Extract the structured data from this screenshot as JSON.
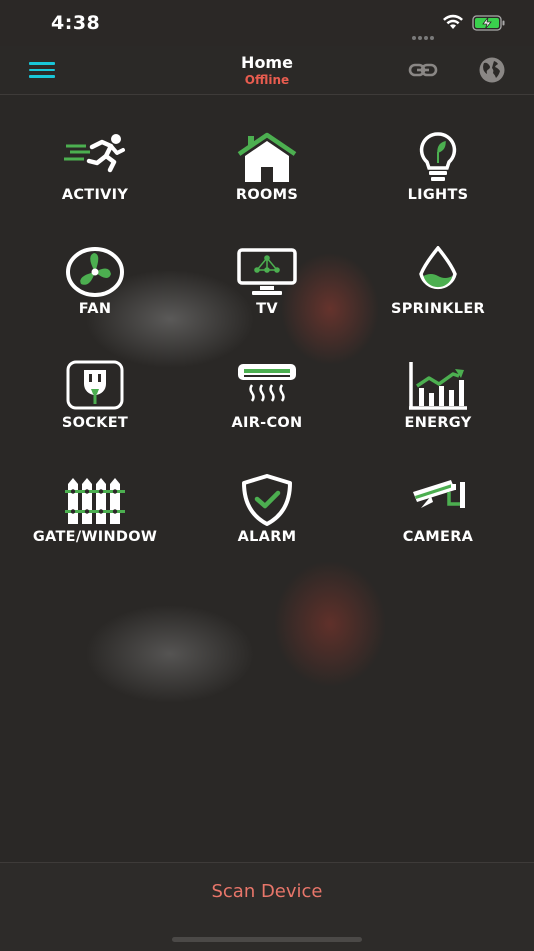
{
  "status_bar": {
    "time": "4:38"
  },
  "header": {
    "title": "Home",
    "status": "Offline"
  },
  "colors": {
    "accent_cyan": "#19c6d8",
    "icon_green": "#4caf50",
    "offline_red": "#e85c4f",
    "scan_text": "#e8766a"
  },
  "devices": [
    {
      "label": "ACTIVIY",
      "icon": "running-person-icon"
    },
    {
      "label": "ROOMS",
      "icon": "house-icon"
    },
    {
      "label": "LIGHTS",
      "icon": "lightbulb-icon"
    },
    {
      "label": "FAN",
      "icon": "fan-icon"
    },
    {
      "label": "TV",
      "icon": "tv-icon"
    },
    {
      "label": "SPRINKLER",
      "icon": "water-drop-icon"
    },
    {
      "label": "SOCKET",
      "icon": "socket-icon"
    },
    {
      "label": "AIR-CON",
      "icon": "air-conditioner-icon"
    },
    {
      "label": "ENERGY",
      "icon": "energy-chart-icon"
    },
    {
      "label": "GATE/WINDOW",
      "icon": "fence-icon"
    },
    {
      "label": "ALARM",
      "icon": "shield-check-icon"
    },
    {
      "label": "CAMERA",
      "icon": "security-camera-icon"
    }
  ],
  "footer": {
    "scan_label": "Scan Device"
  }
}
